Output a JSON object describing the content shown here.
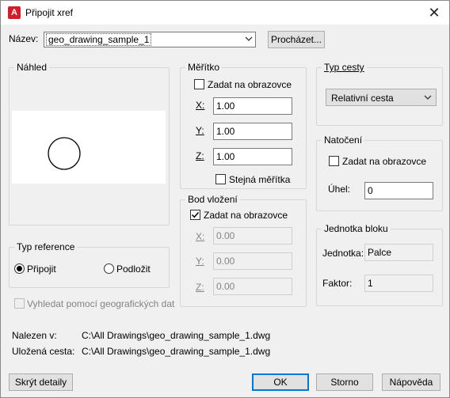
{
  "window": {
    "title": "Připojit xref",
    "close_glyph": "✕",
    "app_icon_letter": "A"
  },
  "name": {
    "label": "Název:",
    "value": "geo_drawing_sample_1",
    "browse_label": "Procházet..."
  },
  "preview": {
    "title": "Náhled"
  },
  "scale": {
    "title": "Měřítko",
    "on_screen_label": "Zadat na obrazovce",
    "x_label": "X:",
    "x_value": "1.00",
    "y_label": "Y:",
    "y_value": "1.00",
    "z_label": "Z:",
    "z_value": "1.00",
    "uniform_label": "Stejná měřítka"
  },
  "path_type": {
    "title": "Typ cesty",
    "value": "Relativní cesta"
  },
  "rotation": {
    "title": "Natočení",
    "on_screen_label": "Zadat na obrazovce",
    "angle_label": "Úhel:",
    "angle_value": "0"
  },
  "insertion": {
    "title": "Bod vložení",
    "on_screen_label": "Zadat na obrazovce",
    "on_screen_checked": true,
    "x_label": "X:",
    "x_value": "0.00",
    "y_label": "Y:",
    "y_value": "0.00",
    "z_label": "Z:",
    "z_value": "0.00"
  },
  "block_unit": {
    "title": "Jednotka bloku",
    "unit_label": "Jednotka:",
    "unit_value": "Palce",
    "factor_label": "Faktor:",
    "factor_value": "1"
  },
  "reference_type": {
    "title": "Typ reference",
    "attach_label": "Připojit",
    "overlay_label": "Podložit",
    "selected": "attach"
  },
  "geo_locate": {
    "label": "Vyhledat pomocí geografických dat"
  },
  "found_in": {
    "label": "Nalezen v:",
    "value": "C:\\All Drawings\\geo_drawing_sample_1.dwg"
  },
  "saved_path": {
    "label": "Uložená cesta:",
    "value": "C:\\All Drawings\\geo_drawing_sample_1.dwg"
  },
  "buttons": {
    "hide_details": "Skrýt detaily",
    "ok": "OK",
    "cancel": "Storno",
    "help": "Nápověda"
  },
  "colors": {
    "accent": "#0078d7",
    "app_icon": "#d21e2b"
  }
}
